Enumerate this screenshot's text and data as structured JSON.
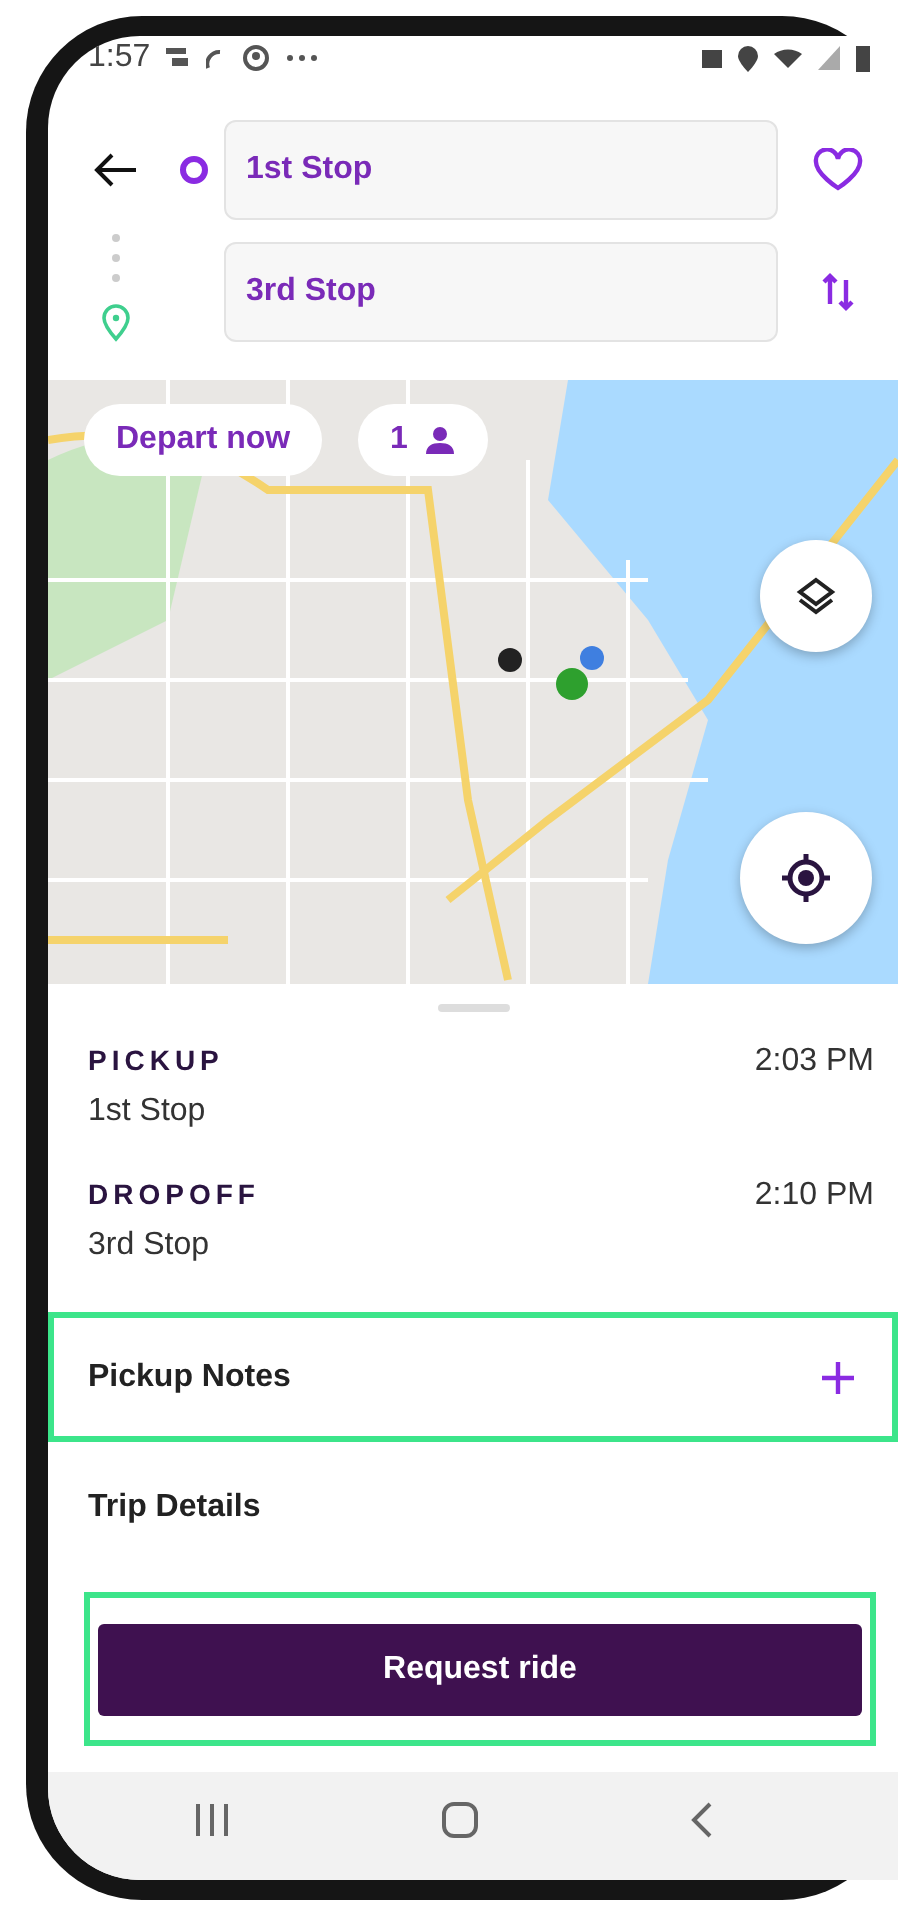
{
  "status_bar": {
    "time": "1:57"
  },
  "route": {
    "stops": [
      {
        "kind": "origin",
        "value": "1st Stop"
      },
      {
        "kind": "destination",
        "value": "3rd Stop"
      }
    ]
  },
  "map": {
    "depart_button": "Depart now",
    "passengers": "1"
  },
  "trip": [
    {
      "label": "PICKUP",
      "place": "1st Stop",
      "time": "2:03 PM"
    },
    {
      "label": "DROPOFF",
      "place": "3rd Stop",
      "time": "2:10 PM"
    }
  ],
  "sections": [
    {
      "kind": "add",
      "label": "Pickup Notes",
      "highlighted": true
    },
    {
      "kind": "plain",
      "label": "Trip Details",
      "highlighted": false
    }
  ],
  "request_button": {
    "label": "Request ride",
    "highlighted": true
  }
}
